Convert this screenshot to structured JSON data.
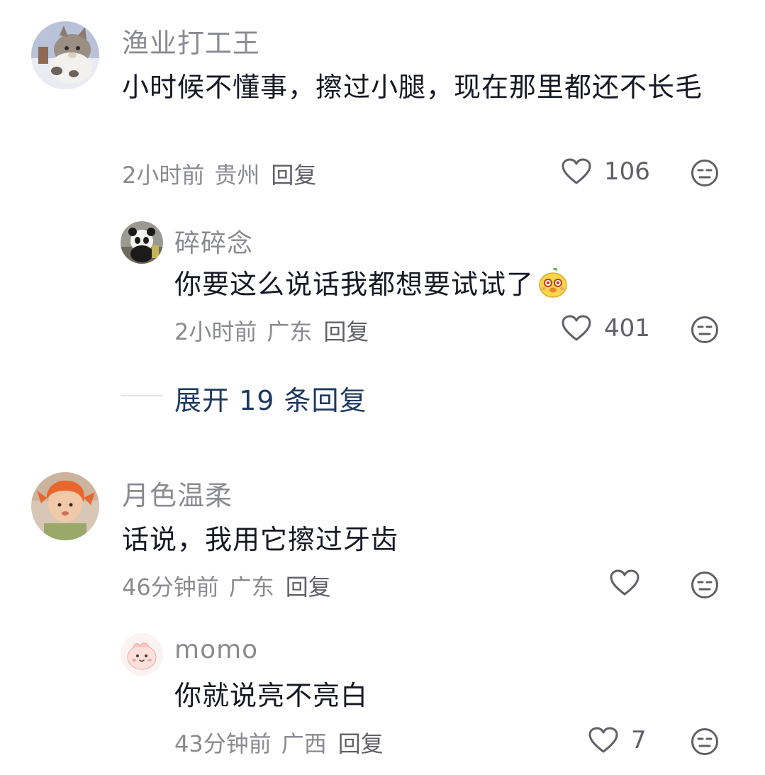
{
  "comments": [
    {
      "username": "渔业打工王",
      "content": "小时候不懂事，擦过小腿，现在那里都还不长毛",
      "time": "2小时前",
      "location": "贵州",
      "reply_label": "回复",
      "likes": "106",
      "replies": [
        {
          "username": "碎碎念",
          "content": "你要这么说话我都想要试试了",
          "time": "2小时前",
          "location": "广东",
          "reply_label": "回复",
          "likes": "401"
        }
      ],
      "expand_label": "展开 19 条回复"
    },
    {
      "username": "月色温柔",
      "content": "话说，我用它擦过牙齿",
      "time": "46分钟前",
      "location": "广东",
      "reply_label": "回复",
      "likes": "",
      "replies": [
        {
          "username": "momo",
          "content": "你就说亮不亮白",
          "time": "43分钟前",
          "location": "广西",
          "reply_label": "回复",
          "likes": "7"
        }
      ]
    }
  ],
  "icons": {
    "like": "heart-outline-icon",
    "dislike": "meh-face-icon",
    "emoji": "yellow-chick-emoji"
  },
  "colors": {
    "text_primary": "#161823",
    "text_secondary": "#8a8b91",
    "expand_link": "#1d3a5f"
  }
}
